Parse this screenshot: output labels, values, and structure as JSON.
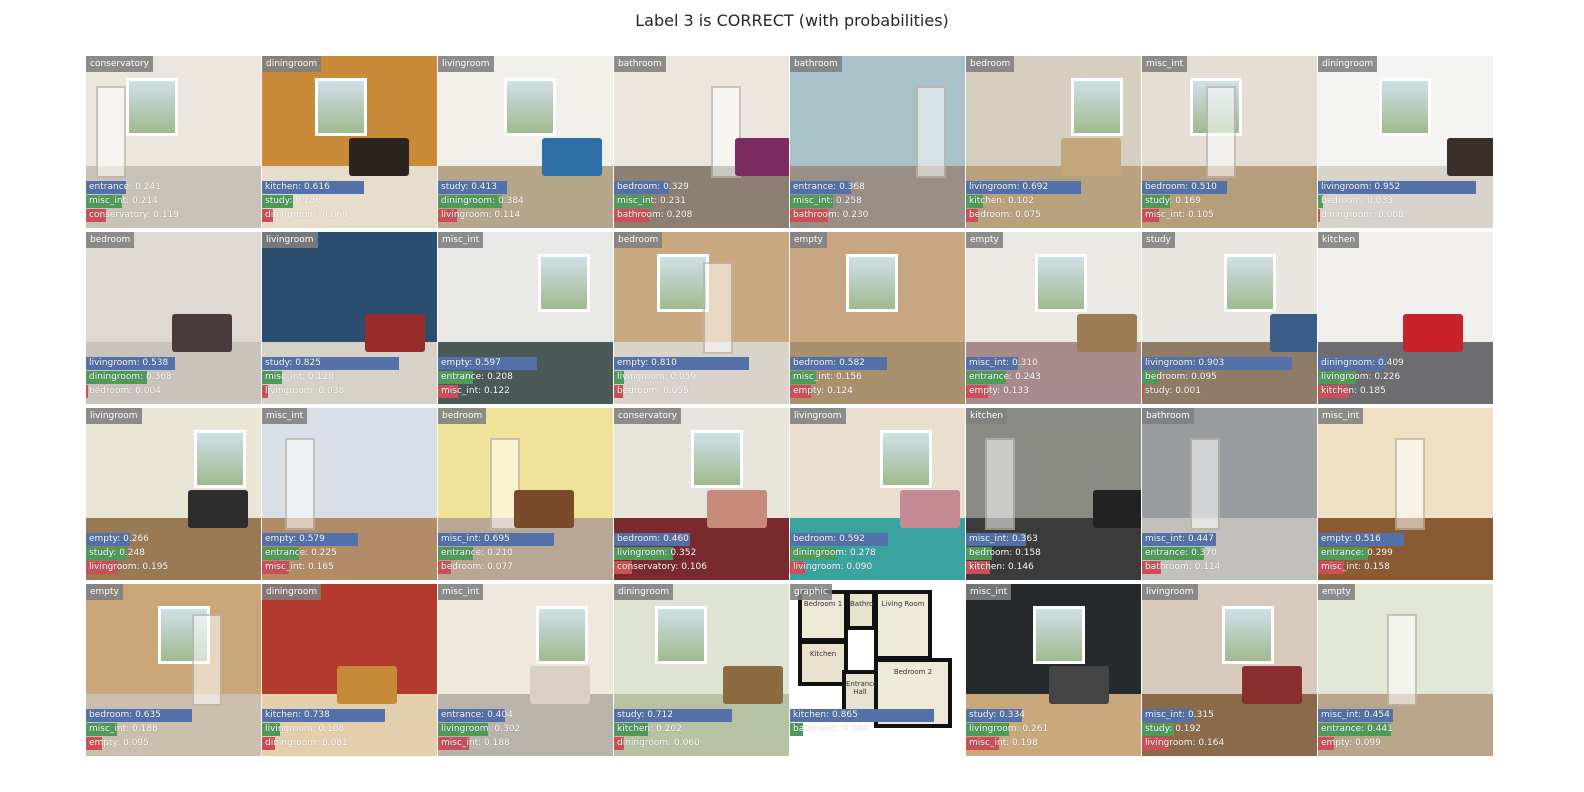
{
  "figure": {
    "title": "Label 3 is CORRECT (with probabilities)"
  },
  "bar_colors": [
    "#5470a8",
    "#4e9a5a",
    "#c95058"
  ],
  "tiles": [
    {
      "label": "conservatory",
      "icon": "photo-conservatory",
      "scene": {
        "wall": "#ece7de",
        "floor": "#c9c2b6",
        "win": true,
        "door": true
      },
      "preds": [
        {
          "text": "entrance: 0.241",
          "p": 0.241
        },
        {
          "text": "misc_int: 0.214",
          "p": 0.214
        },
        {
          "text": "conservatory: 0.119",
          "p": 0.119
        }
      ]
    },
    {
      "label": "diningroom",
      "icon": "photo-diningroom",
      "scene": {
        "wall": "#c98a3a",
        "floor": "#e7ddcc",
        "win": true,
        "furn": "#2b2522"
      },
      "preds": [
        {
          "text": "kitchen: 0.616",
          "p": 0.616
        },
        {
          "text": "study: 0.186",
          "p": 0.186
        },
        {
          "text": "diningroom: 0.068",
          "p": 0.068
        }
      ]
    },
    {
      "label": "livingroom",
      "icon": "photo-livingroom",
      "scene": {
        "wall": "#f1efea",
        "floor": "#b5a58b",
        "win": true,
        "furn": "#2f6fa8"
      },
      "preds": [
        {
          "text": "study: 0.413",
          "p": 0.413
        },
        {
          "text": "diningroom: 0.384",
          "p": 0.384
        },
        {
          "text": "livingroom: 0.114",
          "p": 0.114
        }
      ]
    },
    {
      "label": "bathroom",
      "icon": "photo-bathroom",
      "scene": {
        "wall": "#ece6de",
        "floor": "#8c8072",
        "door": true,
        "furn": "#7b2a62"
      },
      "preds": [
        {
          "text": "bedroom: 0.329",
          "p": 0.329
        },
        {
          "text": "misc_int: 0.231",
          "p": 0.231
        },
        {
          "text": "bathroom: 0.208",
          "p": 0.208
        }
      ]
    },
    {
      "label": "bathroom",
      "icon": "photo-bathroom",
      "scene": {
        "wall": "#a9c2c9",
        "floor": "#9a8f86",
        "door": true
      },
      "preds": [
        {
          "text": "entrance: 0.368",
          "p": 0.368
        },
        {
          "text": "misc_int: 0.258",
          "p": 0.258
        },
        {
          "text": "bathroom: 0.230",
          "p": 0.23
        }
      ]
    },
    {
      "label": "bedroom",
      "icon": "photo-bedroom",
      "scene": {
        "wall": "#d6cfc0",
        "floor": "#b8a17f",
        "win": true,
        "furn": "#c3a77b"
      },
      "preds": [
        {
          "text": "livingroom: 0.692",
          "p": 0.692
        },
        {
          "text": "kitchen: 0.102",
          "p": 0.102
        },
        {
          "text": "bedroom: 0.075",
          "p": 0.075
        }
      ]
    },
    {
      "label": "misc_int",
      "icon": "photo-misc-int",
      "scene": {
        "wall": "#e3ddd3",
        "floor": "#b69e7c",
        "win": true,
        "door": true
      },
      "preds": [
        {
          "text": "bedroom: 0.510",
          "p": 0.51
        },
        {
          "text": "study: 0.169",
          "p": 0.169
        },
        {
          "text": "misc_int: 0.105",
          "p": 0.105
        }
      ]
    },
    {
      "label": "diningroom",
      "icon": "photo-diningroom",
      "scene": {
        "wall": "#f3f3f1",
        "floor": "#d8d4cc",
        "win": true,
        "furn": "#3a2f2a"
      },
      "preds": [
        {
          "text": "livingroom: 0.952",
          "p": 0.952
        },
        {
          "text": "bedroom: 0.033",
          "p": 0.033
        },
        {
          "text": "diningroom: 0.008",
          "p": 0.008
        }
      ]
    },
    {
      "label": "bedroom",
      "icon": "photo-bedroom",
      "scene": {
        "wall": "#dedad3",
        "floor": "#c9c3bb",
        "furn": "#4b3b3d"
      },
      "preds": [
        {
          "text": "livingroom: 0.538",
          "p": 0.538
        },
        {
          "text": "diningroom: 0.368",
          "p": 0.368
        },
        {
          "text": "bedroom: 0.004",
          "p": 0.004
        }
      ]
    },
    {
      "label": "livingroom",
      "icon": "photo-livingroom",
      "scene": {
        "wall": "#2c4e6e",
        "floor": "#d7d2c8",
        "furn": "#9b2c2c"
      },
      "preds": [
        {
          "text": "study: 0.825",
          "p": 0.825
        },
        {
          "text": "misc_int: 0.120",
          "p": 0.12
        },
        {
          "text": "livingroom: 0.038",
          "p": 0.038
        }
      ]
    },
    {
      "label": "misc_int",
      "icon": "photo-misc-int",
      "scene": {
        "wall": "#e9eae8",
        "floor": "#4b5a57",
        "win": true
      },
      "preds": [
        {
          "text": "empty: 0.597",
          "p": 0.597
        },
        {
          "text": "entrance: 0.208",
          "p": 0.208
        },
        {
          "text": "misc_int: 0.122",
          "p": 0.122
        }
      ]
    },
    {
      "label": "bedroom",
      "icon": "photo-bedroom",
      "scene": {
        "wall": "#c9a97f",
        "floor": "#d9d3cb",
        "win": true,
        "door": true
      },
      "preds": [
        {
          "text": "empty: 0.810",
          "p": 0.81
        },
        {
          "text": "livingroom: 0.059",
          "p": 0.059
        },
        {
          "text": "bedroom: 0.055",
          "p": 0.055
        }
      ]
    },
    {
      "label": "empty",
      "icon": "photo-empty",
      "scene": {
        "wall": "#c8a782",
        "floor": "#a9916f",
        "win": true
      },
      "preds": [
        {
          "text": "bedroom: 0.582",
          "p": 0.582
        },
        {
          "text": "misc_int: 0.156",
          "p": 0.156
        },
        {
          "text": "empty: 0.124",
          "p": 0.124
        }
      ]
    },
    {
      "label": "empty",
      "icon": "photo-empty",
      "scene": {
        "wall": "#ece9e4",
        "floor": "#a88b8d",
        "win": true,
        "furn": "#9b7b52"
      },
      "preds": [
        {
          "text": "misc_int: 0.310",
          "p": 0.31
        },
        {
          "text": "entrance: 0.243",
          "p": 0.243
        },
        {
          "text": "empty: 0.133",
          "p": 0.133
        }
      ]
    },
    {
      "label": "study",
      "icon": "photo-study",
      "scene": {
        "wall": "#e8e6df",
        "floor": "#8e7c68",
        "win": true,
        "furn": "#3c5d8a"
      },
      "preds": [
        {
          "text": "livingroom: 0.903",
          "p": 0.903
        },
        {
          "text": "bedroom: 0.095",
          "p": 0.095
        },
        {
          "text": "study: 0.001",
          "p": 0.001
        }
      ]
    },
    {
      "label": "kitchen",
      "icon": "photo-kitchen",
      "scene": {
        "wall": "#f1efec",
        "floor": "#6d6d70",
        "furn": "#c8232b"
      },
      "preds": [
        {
          "text": "diningroom: 0.409",
          "p": 0.409
        },
        {
          "text": "livingroom: 0.226",
          "p": 0.226
        },
        {
          "text": "kitchen: 0.185",
          "p": 0.185
        }
      ]
    },
    {
      "label": "livingroom",
      "icon": "photo-livingroom",
      "scene": {
        "wall": "#e9e6d6",
        "floor": "#9a7a55",
        "win": true,
        "furn": "#2d2d2d"
      },
      "preds": [
        {
          "text": "empty: 0.266",
          "p": 0.266
        },
        {
          "text": "study: 0.248",
          "p": 0.248
        },
        {
          "text": "livingroom: 0.195",
          "p": 0.195
        }
      ]
    },
    {
      "label": "misc_int",
      "icon": "photo-misc-int",
      "scene": {
        "wall": "#d8dfe6",
        "floor": "#b18c66",
        "door": true
      },
      "preds": [
        {
          "text": "empty: 0.579",
          "p": 0.579
        },
        {
          "text": "entrance: 0.225",
          "p": 0.225
        },
        {
          "text": "misc_int: 0.165",
          "p": 0.165
        }
      ]
    },
    {
      "label": "bedroom",
      "icon": "photo-bedroom",
      "scene": {
        "wall": "#efe39a",
        "floor": "#b7a794",
        "door": true,
        "furn": "#7a4b2a"
      },
      "preds": [
        {
          "text": "misc_int: 0.695",
          "p": 0.695
        },
        {
          "text": "entrance: 0.210",
          "p": 0.21
        },
        {
          "text": "bedroom: 0.077",
          "p": 0.077
        }
      ]
    },
    {
      "label": "conservatory",
      "icon": "photo-conservatory",
      "scene": {
        "wall": "#e7e4dc",
        "floor": "#7a2a2e",
        "win": true,
        "furn": "#c88a7a"
      },
      "preds": [
        {
          "text": "bedroom: 0.460",
          "p": 0.46
        },
        {
          "text": "livingroom: 0.352",
          "p": 0.352
        },
        {
          "text": "conservatory: 0.106",
          "p": 0.106
        }
      ]
    },
    {
      "label": "livingroom",
      "icon": "photo-livingroom",
      "scene": {
        "wall": "#eadfce",
        "floor": "#3aa3a0",
        "win": true,
        "furn": "#c48b95"
      },
      "preds": [
        {
          "text": "bedroom: 0.592",
          "p": 0.592
        },
        {
          "text": "diningroom: 0.278",
          "p": 0.278
        },
        {
          "text": "livingroom: 0.090",
          "p": 0.09
        }
      ]
    },
    {
      "label": "kitchen",
      "icon": "photo-kitchen",
      "scene": {
        "wall": "#8b8b86",
        "floor": "#3b3b3b",
        "door": true,
        "furn": "#222222"
      },
      "preds": [
        {
          "text": "misc_int: 0.363",
          "p": 0.363
        },
        {
          "text": "bedroom: 0.158",
          "p": 0.158
        },
        {
          "text": "kitchen: 0.146",
          "p": 0.146
        }
      ]
    },
    {
      "label": "bathroom",
      "icon": "photo-bathroom",
      "scene": {
        "wall": "#9a9da0",
        "floor": "#c2c0bc",
        "door": true
      },
      "preds": [
        {
          "text": "misc_int: 0.447",
          "p": 0.447
        },
        {
          "text": "entrance: 0.370",
          "p": 0.37
        },
        {
          "text": "bathroom: 0.114",
          "p": 0.114
        }
      ]
    },
    {
      "label": "misc_int",
      "icon": "photo-misc-int",
      "scene": {
        "wall": "#efe0c3",
        "floor": "#8a5a33",
        "door": true
      },
      "preds": [
        {
          "text": "empty: 0.516",
          "p": 0.516
        },
        {
          "text": "entrance: 0.299",
          "p": 0.299
        },
        {
          "text": "misc_int: 0.158",
          "p": 0.158
        }
      ]
    },
    {
      "label": "empty",
      "icon": "photo-empty",
      "scene": {
        "wall": "#c9a678",
        "floor": "#cdbfae",
        "win": true,
        "door": true
      },
      "preds": [
        {
          "text": "bedroom: 0.635",
          "p": 0.635
        },
        {
          "text": "misc_int: 0.188",
          "p": 0.188
        },
        {
          "text": "empty: 0.095",
          "p": 0.095
        }
      ]
    },
    {
      "label": "diningroom",
      "icon": "photo-diningroom",
      "scene": {
        "wall": "#b43a2e",
        "floor": "#e3cfae",
        "furn": "#c58a3a"
      },
      "preds": [
        {
          "text": "kitchen: 0.738",
          "p": 0.738
        },
        {
          "text": "livingroom: 0.108",
          "p": 0.108
        },
        {
          "text": "diningroom: 0.081",
          "p": 0.081
        }
      ]
    },
    {
      "label": "misc_int",
      "icon": "photo-misc-int",
      "scene": {
        "wall": "#efe8dc",
        "floor": "#b9b4ab",
        "win": true,
        "furn": "#d9d2c4"
      },
      "preds": [
        {
          "text": "entrance: 0.404",
          "p": 0.404
        },
        {
          "text": "livingroom: 0.302",
          "p": 0.302
        },
        {
          "text": "misc_int: 0.188",
          "p": 0.188
        }
      ]
    },
    {
      "label": "diningroom",
      "icon": "photo-diningroom",
      "scene": {
        "wall": "#dfe3d3",
        "floor": "#b7c1a4",
        "win": true,
        "furn": "#8a6a3e"
      },
      "preds": [
        {
          "text": "study: 0.712",
          "p": 0.712
        },
        {
          "text": "kitchen: 0.202",
          "p": 0.202
        },
        {
          "text": "diningroom: 0.060",
          "p": 0.06
        }
      ]
    },
    {
      "label": "graphic",
      "icon": "floor-plan-graphic",
      "scene": {
        "plan": true
      },
      "plan_rooms": [
        "Bedroom 1",
        "Bathroom",
        "Living Room",
        "Kitchen",
        "Bedroom 2",
        "Entrance Hall"
      ],
      "preds": [
        {
          "text": "kitchen: 0.865",
          "p": 0.865
        },
        {
          "text": "bathroom: 0.080",
          "p": 0.08
        },
        {
          "text": "",
          "p": 0.0
        }
      ]
    },
    {
      "label": "misc_int",
      "icon": "photo-misc-int",
      "scene": {
        "wall": "#26292c",
        "floor": "#c9a97c",
        "win": true,
        "furn": "#444444"
      },
      "preds": [
        {
          "text": "study: 0.334",
          "p": 0.334
        },
        {
          "text": "livingroom: 0.261",
          "p": 0.261
        },
        {
          "text": "misc_int: 0.198",
          "p": 0.198
        }
      ]
    },
    {
      "label": "livingroom",
      "icon": "photo-livingroom",
      "scene": {
        "wall": "#d8cbbd",
        "floor": "#8a6a4a",
        "win": true,
        "furn": "#8a2f2f"
      },
      "preds": [
        {
          "text": "misc_int: 0.315",
          "p": 0.315
        },
        {
          "text": "study: 0.192",
          "p": 0.192
        },
        {
          "text": "livingroom: 0.164",
          "p": 0.164
        }
      ]
    },
    {
      "label": "empty",
      "icon": "photo-empty",
      "scene": {
        "wall": "#e2e6d4",
        "floor": "#b9a58a",
        "door": true
      },
      "preds": [
        {
          "text": "misc_int: 0.454",
          "p": 0.454
        },
        {
          "text": "entrance: 0.441",
          "p": 0.441
        },
        {
          "text": "empty: 0.099",
          "p": 0.099
        }
      ]
    }
  ]
}
